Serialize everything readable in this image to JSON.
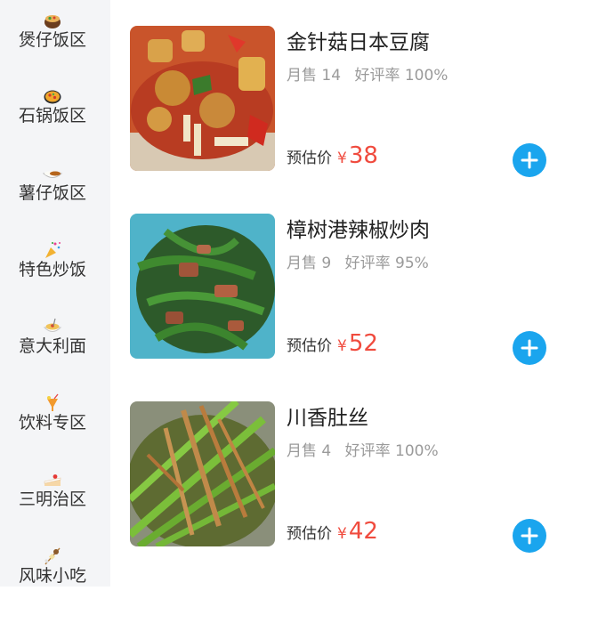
{
  "sidebar": {
    "items": [
      {
        "label": "煲仔饭区",
        "icon": "claypot-bowl-icon"
      },
      {
        "label": "石锅饭区",
        "icon": "paella-pan-icon"
      },
      {
        "label": "薯仔饭区",
        "icon": "curry-rice-icon"
      },
      {
        "label": "特色炒饭",
        "icon": "party-popper-icon"
      },
      {
        "label": "意大利面",
        "icon": "spaghetti-icon"
      },
      {
        "label": "饮料专区",
        "icon": "tropical-drink-icon"
      },
      {
        "label": "三明治区",
        "icon": "shortcake-icon"
      },
      {
        "label": "风味小吃",
        "icon": "skewer-oden-icon"
      }
    ]
  },
  "dishes": [
    {
      "name": "金针菇日本豆腐",
      "sales": "月售 14",
      "rating": "好评率 100%",
      "price_label": "预估价",
      "currency": "¥",
      "price": "38"
    },
    {
      "name": "樟树港辣椒炒肉",
      "sales": "月售 9",
      "rating": "好评率 95%",
      "price_label": "预估价",
      "currency": "¥",
      "price": "52"
    },
    {
      "name": "川香肚丝",
      "sales": "月售 4",
      "rating": "好评率 100%",
      "price_label": "预估价",
      "currency": "¥",
      "price": "42"
    }
  ],
  "colors": {
    "accent": "#1aa5ee",
    "price": "#f04b3e",
    "sidebar_bg": "#f4f5f7"
  }
}
